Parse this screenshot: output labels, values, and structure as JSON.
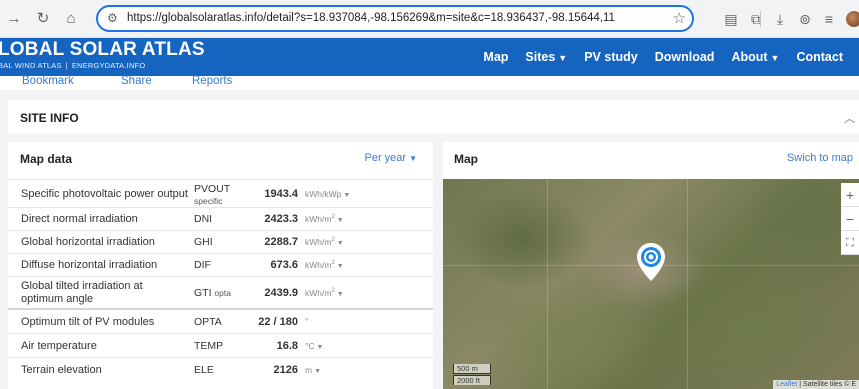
{
  "browser": {
    "url": "https://globalsolaratlas.info/detail?s=18.937084,-98.156269&m=site&c=18.936437,-98.15644,11",
    "icons": [
      "forward-icon",
      "reload-icon",
      "home-icon",
      "site-settings-icon",
      "star-icon",
      "reader-icon",
      "extensions-icon",
      "download-icon",
      "extension-icon",
      "reading-list-icon",
      "avatar"
    ]
  },
  "header": {
    "title": "LOBAL SOLAR ATLAS",
    "sub_left": "BAL WIND ATLAS",
    "sub_sep": "|",
    "sub_right": "ENERGYDATA.INFO",
    "nav": {
      "map": "Map",
      "sites": "Sites",
      "pv_study": "PV study",
      "download": "Download",
      "about": "About",
      "contact": "Contact"
    },
    "accent_color": "#1565c0"
  },
  "sub_links": {
    "bookmark": "Bookmark",
    "share": "Share",
    "reports": "Reports"
  },
  "site_info": {
    "title": "SITE INFO"
  },
  "map_data": {
    "title": "Map data",
    "period_select": "Per year",
    "rows": [
      {
        "label": "Specific photovoltaic power output",
        "abbr": "PVOUT",
        "abbr_sub": "specific",
        "value": "1943.4",
        "unit": "kWh/kWp"
      },
      {
        "label": "Direct normal irradiation",
        "abbr": "DNI",
        "value": "2423.3",
        "unit": "kWh/m",
        "unit_sup": "2"
      },
      {
        "label": "Global horizontal irradiation",
        "abbr": "GHI",
        "value": "2288.7",
        "unit": "kWh/m",
        "unit_sup": "2"
      },
      {
        "label": "Diffuse horizontal irradiation",
        "abbr": "DIF",
        "value": "673.6",
        "unit": "kWh/m",
        "unit_sup": "2"
      },
      {
        "label": "Global tilted irradiation at",
        "label2": "optimum angle",
        "abbr": "GTI",
        "abbr_sub": "opta",
        "value": "2439.9",
        "unit": "kWh/m",
        "unit_sup": "2"
      },
      {
        "label": "Optimum tilt of PV modules",
        "abbr": "OPTA",
        "value": "22 / 180",
        "unit": "°"
      },
      {
        "label": "Air temperature",
        "abbr": "TEMP",
        "value": "16.8",
        "unit": "°C"
      },
      {
        "label": "Terrain elevation",
        "abbr": "ELE",
        "value": "2126",
        "unit": "m"
      }
    ]
  },
  "map_panel": {
    "title": "Map",
    "switch_label": "Swich to map",
    "zoom_in": "+",
    "zoom_out": "−",
    "fullscreen": "⛶",
    "scale_metric": "500 m",
    "scale_imperial": "2000 ft",
    "attribution_link": "Leaflet",
    "attribution_text": "Satellite tiles © E"
  }
}
